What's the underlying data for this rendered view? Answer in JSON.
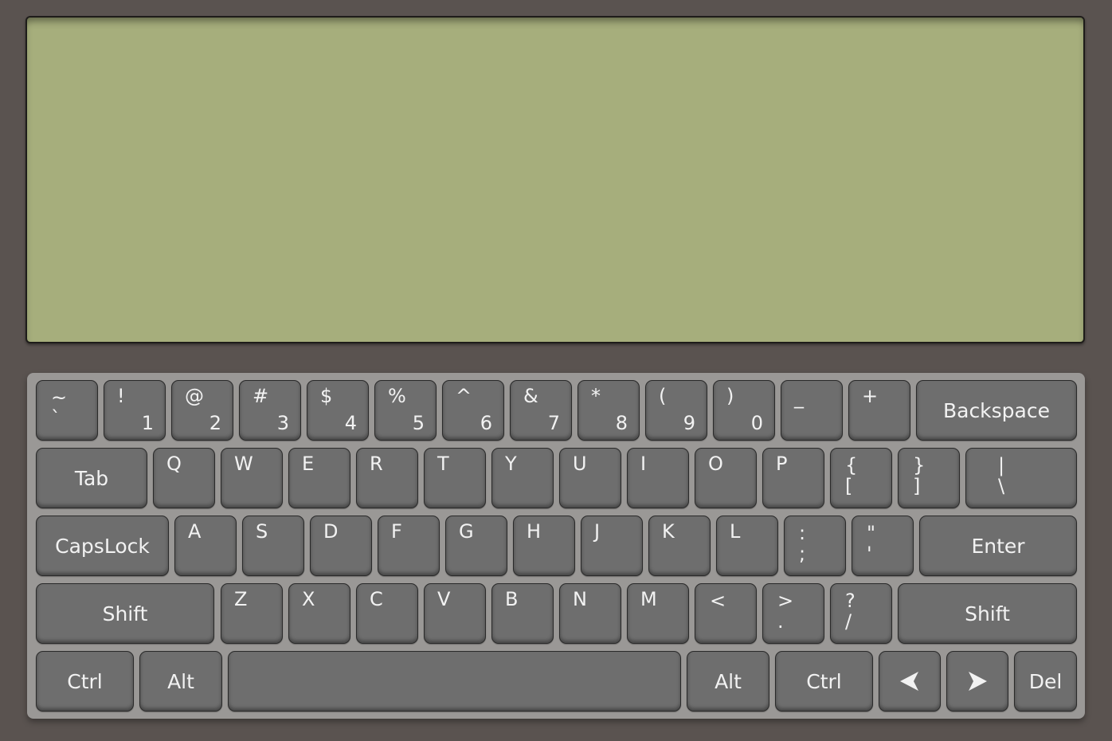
{
  "row1": [
    {
      "top": "~",
      "bot": "`"
    },
    {
      "top": "!",
      "bot": "1"
    },
    {
      "top": "@",
      "bot": "2"
    },
    {
      "top": "#",
      "bot": "3"
    },
    {
      "top": "$",
      "bot": "4"
    },
    {
      "top": "%",
      "bot": "5"
    },
    {
      "top": "^",
      "bot": "6"
    },
    {
      "top": "&",
      "bot": "7"
    },
    {
      "top": "*",
      "bot": "8"
    },
    {
      "top": "(",
      "bot": "9"
    },
    {
      "top": ")",
      "bot": "0"
    },
    {
      "top": "_",
      "bot": ""
    },
    {
      "top": "+",
      "bot": ""
    }
  ],
  "backspace": "Backspace",
  "tab": "Tab",
  "row2": [
    "Q",
    "W",
    "E",
    "R",
    "T",
    "Y",
    "U",
    "I",
    "O",
    "P"
  ],
  "row2_sym": [
    {
      "top": "{",
      "bot": "["
    },
    {
      "top": "}",
      "bot": "]"
    },
    {
      "top": "|",
      "bot": "\\"
    }
  ],
  "capslock": "CapsLock",
  "row3": [
    "A",
    "S",
    "D",
    "F",
    "G",
    "H",
    "J",
    "K",
    "L"
  ],
  "row3_sym": [
    {
      "top": ":",
      "bot": ";"
    },
    {
      "top": "\"",
      "bot": "'"
    }
  ],
  "enter": "Enter",
  "shift_left": "Shift",
  "row4": [
    "Z",
    "X",
    "C",
    "V",
    "B",
    "N",
    "M"
  ],
  "row4_sym": [
    {
      "top": "<",
      "bot": ""
    },
    {
      "top": ">",
      "bot": "."
    },
    {
      "top": "?",
      "bot": "/"
    }
  ],
  "shift_right": "Shift",
  "ctrl_left": "Ctrl",
  "alt_left": "Alt",
  "alt_right": "Alt",
  "ctrl_right": "Ctrl",
  "arrow_left_icon": "arrow-left-icon",
  "arrow_right_icon": "arrow-right-icon",
  "del": "Del"
}
